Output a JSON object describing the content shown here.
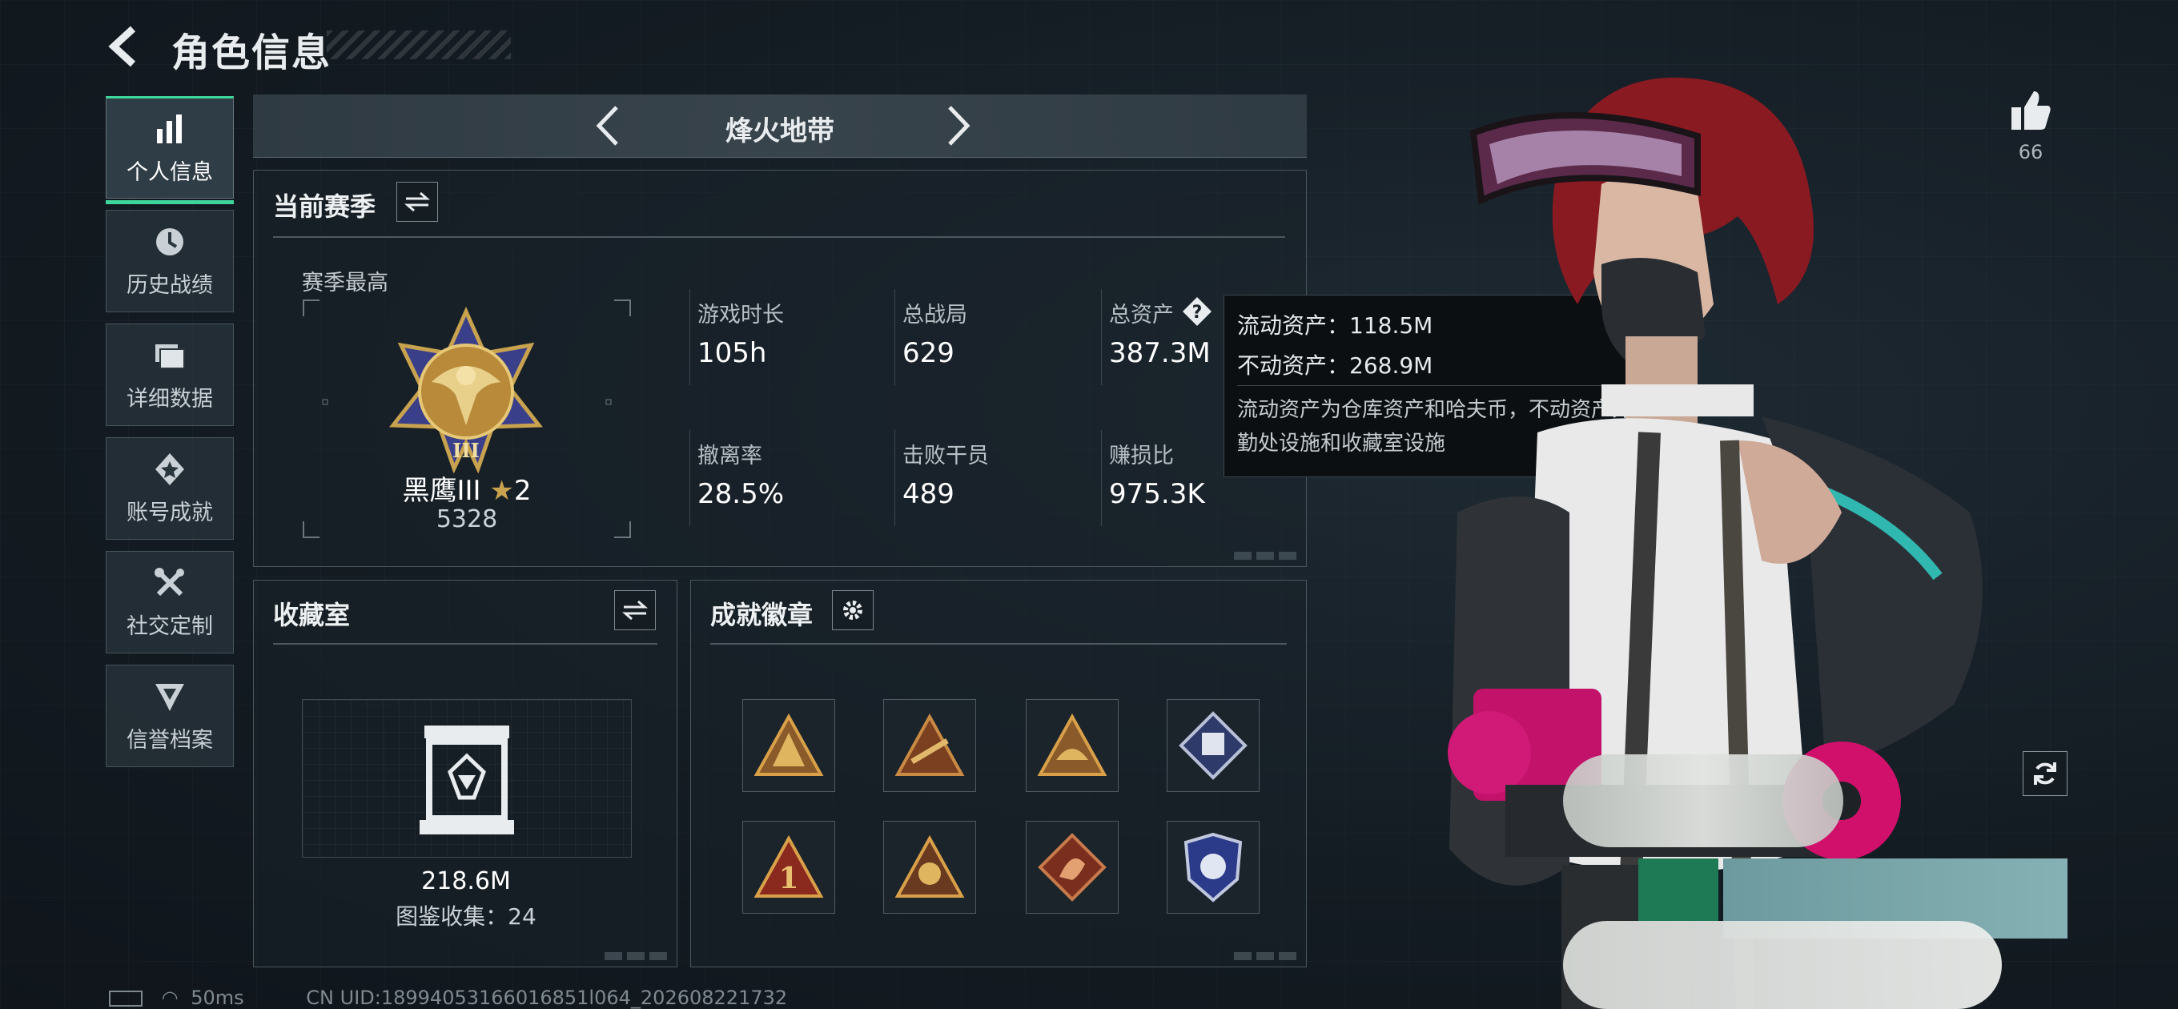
{
  "header": {
    "title": "角色信息"
  },
  "nav": {
    "items": [
      {
        "label": "个人信息",
        "icon": "bar-chart-icon",
        "active": true
      },
      {
        "label": "历史战绩",
        "icon": "history-clock-icon",
        "active": false
      },
      {
        "label": "详细数据",
        "icon": "folder-icon",
        "active": false
      },
      {
        "label": "账号成就",
        "icon": "achievement-star-icon",
        "active": false
      },
      {
        "label": "社交定制",
        "icon": "tools-icon",
        "active": false
      },
      {
        "label": "信誉档案",
        "icon": "shield-emblem-icon",
        "active": false
      }
    ]
  },
  "mode": {
    "title": "烽火地带"
  },
  "season": {
    "title": "当前赛季",
    "best_label": "赛季最高",
    "rank_name": "黑鹰III",
    "rank_stars": "2",
    "rank_score": "5328",
    "stats": [
      {
        "label": "游戏时长",
        "value": "105h"
      },
      {
        "label": "总战局",
        "value": "629"
      },
      {
        "label": "总资产",
        "value": "387.3M"
      },
      {
        "label": "撤离率",
        "value": "28.5%"
      },
      {
        "label": "击败干员",
        "value": "489"
      },
      {
        "label": "赚损比",
        "value": "975.3K"
      }
    ]
  },
  "tooltip": {
    "liquid": "流动资产：118.5M",
    "fixed": "不动资产：268.9M",
    "desc": "流动资产为仓库资产和哈夫币，不动资产为特勤处设施和收藏室设施"
  },
  "collection": {
    "title": "收藏室",
    "value": "218.6M",
    "catalog": "图鉴收集：24"
  },
  "achievements": {
    "title": "成就徽章"
  },
  "profile": {
    "likes": "66"
  },
  "footer": {
    "ping": "50ms",
    "uid": "CN UID:18994053166016851l064_202608221732"
  },
  "colors": {
    "accent": "#3ed59b",
    "gold": "#c8a24e",
    "panel_border": "#4a565d"
  }
}
